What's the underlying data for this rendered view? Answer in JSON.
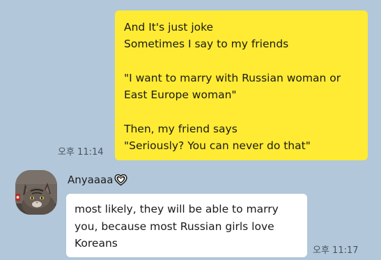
{
  "outgoing": {
    "lines": [
      "And It's just joke",
      "Sometimes I say to my friends",
      "",
      "\"I want to marry with Russian woman or",
      "East Europe woman\"",
      "",
      "Then, my friend says",
      "\"Seriously? You can never do that\""
    ],
    "time": "오후 11:14"
  },
  "incoming": {
    "sender": "Anyaaaa",
    "sender_icon": "heart-icon",
    "lines": [
      "most likely, they will be able to marry",
      "you, because most Russian girls love",
      "Koreans"
    ],
    "time": "오후 11:17"
  },
  "colors": {
    "background": "#b2c7d9",
    "outgoing_bubble": "#ffeb33",
    "incoming_bubble": "#ffffff"
  }
}
